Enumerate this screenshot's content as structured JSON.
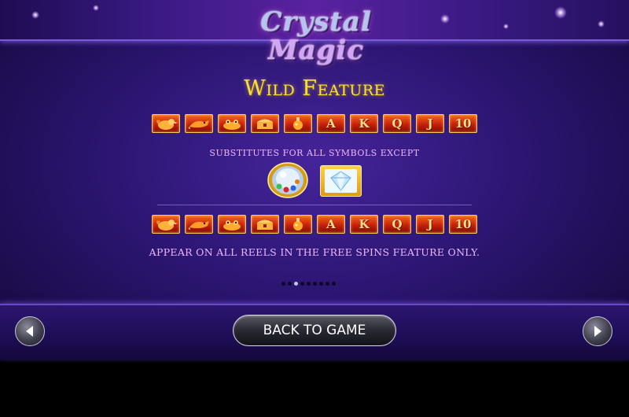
{
  "logo": {
    "line1": "Crystal",
    "line2": "Magic"
  },
  "heading": "Wild Feature",
  "symbols_top": [
    {
      "name": "bird-icon",
      "letter": ""
    },
    {
      "name": "fox-icon",
      "letter": ""
    },
    {
      "name": "frog-icon",
      "letter": ""
    },
    {
      "name": "treasure-chest-icon",
      "letter": ""
    },
    {
      "name": "potion-icon",
      "letter": ""
    },
    {
      "name": "letter-a",
      "letter": "A"
    },
    {
      "name": "letter-k",
      "letter": "K"
    },
    {
      "name": "letter-q",
      "letter": "Q"
    },
    {
      "name": "letter-j",
      "letter": "J"
    },
    {
      "name": "number-10",
      "letter": "10"
    }
  ],
  "substitutes_text": "SUBSTITUTES FOR ALL SYMBOLS EXCEPT",
  "except_symbols": [
    "crystal-ball-bonus-icon",
    "diamond-icon"
  ],
  "symbols_bottom": [
    {
      "name": "bird-icon",
      "letter": ""
    },
    {
      "name": "fox-icon",
      "letter": ""
    },
    {
      "name": "frog-icon",
      "letter": ""
    },
    {
      "name": "treasure-chest-icon",
      "letter": ""
    },
    {
      "name": "potion-icon",
      "letter": ""
    },
    {
      "name": "letter-a",
      "letter": "A"
    },
    {
      "name": "letter-k",
      "letter": "K"
    },
    {
      "name": "letter-q",
      "letter": "Q"
    },
    {
      "name": "letter-j",
      "letter": "J"
    },
    {
      "name": "number-10",
      "letter": "10"
    }
  ],
  "footer_text": "APPEAR ON ALL REELS IN THE FREE SPINS FEATURE ONLY.",
  "pagination": {
    "total": 9,
    "current": 3
  },
  "buttons": {
    "back": "BACK TO GAME",
    "prev_icon": "arrow-left-icon",
    "next_icon": "arrow-right-icon"
  },
  "colors": {
    "heading": "#f7de44",
    "body_text": "#f0b7ff",
    "background": "#2c1673",
    "tile": "#c8200c"
  }
}
